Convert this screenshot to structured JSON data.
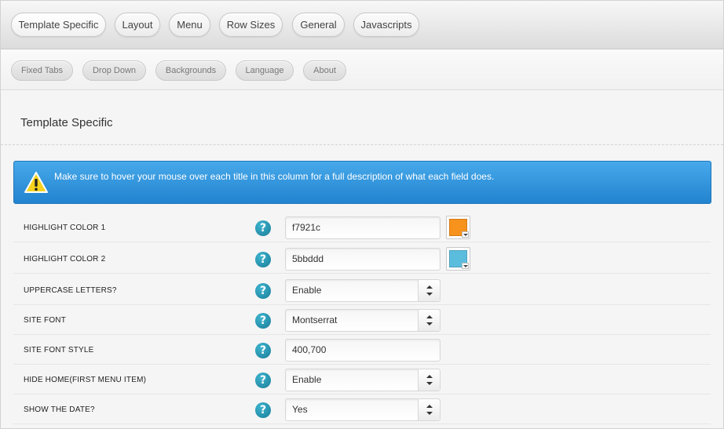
{
  "tabs_primary": [
    {
      "label": "Template Specific"
    },
    {
      "label": "Layout"
    },
    {
      "label": "Menu"
    },
    {
      "label": "Row Sizes"
    },
    {
      "label": "General"
    },
    {
      "label": "Javascripts"
    }
  ],
  "tabs_secondary": [
    {
      "label": "Fixed Tabs"
    },
    {
      "label": "Drop Down"
    },
    {
      "label": "Backgrounds"
    },
    {
      "label": "Language"
    },
    {
      "label": "About"
    }
  ],
  "section": {
    "title": "Template Specific"
  },
  "banner": {
    "icon": "warning-icon",
    "text": "Make sure to hover your mouse over each title in this column for a full description of what each field does."
  },
  "help_icon": {
    "glyph": "?"
  },
  "fields": [
    {
      "label": "HIGHLIGHT COLOR 1",
      "value": "f7921c",
      "kind": "color",
      "color": "#f7921c"
    },
    {
      "label": "HIGHLIGHT COLOR 2",
      "value": "5bbddd",
      "kind": "color",
      "color": "#5bbddd"
    },
    {
      "label": "UPPERCASE LETTERS?",
      "value": "Enable",
      "kind": "select"
    },
    {
      "label": "SITE FONT",
      "value": "Montserrat",
      "kind": "select"
    },
    {
      "label": "SITE FONT STYLE",
      "value": "400,700",
      "kind": "text"
    },
    {
      "label": "HIDE HOME(FIRST MENU ITEM)",
      "value": "Enable",
      "kind": "select"
    },
    {
      "label": "SHOW THE DATE?",
      "value": "Yes",
      "kind": "select"
    }
  ]
}
